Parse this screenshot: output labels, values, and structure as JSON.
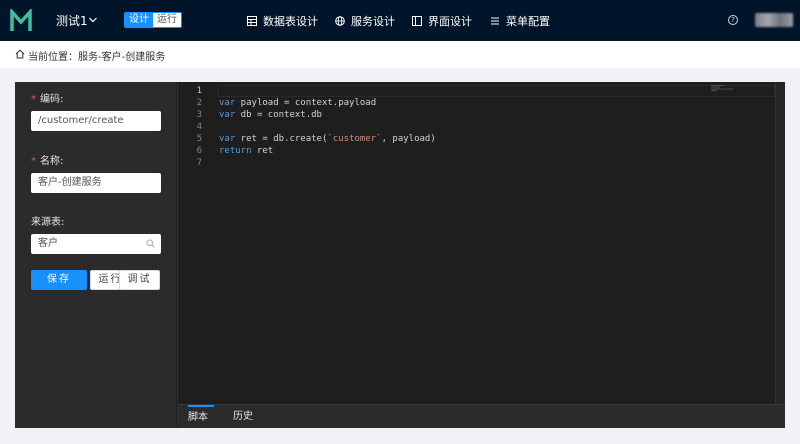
{
  "header": {
    "logo_letter": "M",
    "project_name": "测试1",
    "mode_design": "设计",
    "mode_run": "运行",
    "nav": [
      {
        "label": "数据表设计",
        "icon": "table-icon"
      },
      {
        "label": "服务设计",
        "icon": "globe-icon"
      },
      {
        "label": "界面设计",
        "icon": "layout-icon"
      },
      {
        "label": "菜单配置",
        "icon": "menu-icon"
      }
    ],
    "help": "?"
  },
  "breadcrumb": {
    "text": "当前位置：服务-客户-创建服务"
  },
  "form": {
    "code_label": "编码:",
    "code_value": "/customer/create",
    "name_label": "名称:",
    "name_value": "客户-创建服务",
    "source_label": "来源表:",
    "source_value": "客户",
    "save": "保存",
    "run": "运行",
    "debug": "调试"
  },
  "editor": {
    "line_numbers": [
      "1",
      "2",
      "3",
      "4",
      "5",
      "6",
      "7"
    ],
    "lines": [
      {
        "kw": "",
        "rest": "",
        "str": "",
        "tail": ""
      },
      {
        "kw": "var",
        "rest": " payload = context.payload",
        "str": "",
        "tail": ""
      },
      {
        "kw": "var",
        "rest": " db = context.db",
        "str": "",
        "tail": ""
      },
      {
        "kw": "",
        "rest": "",
        "str": "",
        "tail": ""
      },
      {
        "kw": "var",
        "rest": " ret = db.create(",
        "str": "`customer`",
        "tail": ", payload)"
      },
      {
        "kw": "return",
        "rest": " ret",
        "str": "",
        "tail": ""
      },
      {
        "kw": "",
        "rest": "",
        "str": "",
        "tail": ""
      }
    ]
  },
  "tabs": {
    "script": "脚本",
    "history": "历史"
  },
  "colors": {
    "header_bg": "#001529",
    "accent": "#1890ff",
    "logo": "#3fbf9f",
    "editor_bg": "#1e1e1e",
    "panel_bg": "#2b2b2b"
  }
}
